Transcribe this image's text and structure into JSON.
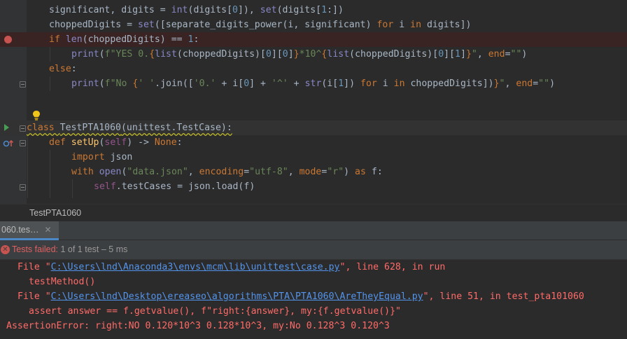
{
  "editor": {
    "lines": [
      {
        "id": "l1",
        "parts": [
          [
            "significant, digits = ",
            ""
          ],
          [
            "int",
            "bi"
          ],
          [
            "(digits[",
            ""
          ],
          [
            "0",
            "num"
          ],
          [
            "]), ",
            ""
          ],
          [
            "set",
            "bi"
          ],
          [
            "(digits[",
            ""
          ],
          [
            "1",
            "num"
          ],
          [
            ":])",
            ""
          ]
        ]
      },
      {
        "id": "l2",
        "parts": [
          [
            "choppedDigits = ",
            ""
          ],
          [
            "set",
            "bi"
          ],
          [
            "([separate_digits_power(i, significant) ",
            ""
          ],
          [
            "for",
            "kw"
          ],
          [
            " i ",
            ""
          ],
          [
            "in",
            "kw"
          ],
          [
            " digits])",
            ""
          ]
        ]
      },
      {
        "id": "l3",
        "parts": [
          [
            "if ",
            "kw"
          ],
          [
            "len",
            "bi"
          ],
          [
            "(choppedDigits) == ",
            ""
          ],
          [
            "1",
            "num"
          ],
          [
            ":",
            ""
          ]
        ]
      },
      {
        "id": "l4",
        "parts": [
          [
            "print",
            "bi"
          ],
          [
            "(",
            ""
          ],
          [
            "f\"YES 0.",
            "str"
          ],
          [
            "{",
            "esc"
          ],
          [
            "list",
            "bi"
          ],
          [
            "(choppedDigits)[",
            ""
          ],
          [
            "0",
            "num"
          ],
          [
            "][",
            ""
          ],
          [
            "0",
            "num"
          ],
          [
            "]",
            ""
          ],
          [
            "}",
            "esc"
          ],
          [
            "*10^",
            "str"
          ],
          [
            "{",
            "esc"
          ],
          [
            "list",
            "bi"
          ],
          [
            "(choppedDigits)[",
            ""
          ],
          [
            "0",
            "num"
          ],
          [
            "][",
            ""
          ],
          [
            "1",
            "num"
          ],
          [
            "]",
            ""
          ],
          [
            "}",
            "esc"
          ],
          [
            "\"",
            "str"
          ],
          [
            ", ",
            ""
          ],
          [
            "end",
            "kw"
          ],
          [
            "=",
            ""
          ],
          [
            "\"\"",
            "str"
          ],
          [
            ")",
            ""
          ]
        ]
      },
      {
        "id": "l5",
        "parts": [
          [
            "else",
            "kw"
          ],
          [
            ":",
            ""
          ]
        ]
      },
      {
        "id": "l6",
        "parts": [
          [
            "print",
            "bi"
          ],
          [
            "(",
            ""
          ],
          [
            "f\"No ",
            "str"
          ],
          [
            "{",
            "esc"
          ],
          [
            "' '",
            "str"
          ],
          [
            ".join([",
            ""
          ],
          [
            "'0.'",
            "str"
          ],
          [
            " + i[",
            ""
          ],
          [
            "0",
            "num"
          ],
          [
            "] + ",
            ""
          ],
          [
            "'^'",
            "str"
          ],
          [
            " + ",
            ""
          ],
          [
            "str",
            "bi"
          ],
          [
            "(i[",
            ""
          ],
          [
            "1",
            "num"
          ],
          [
            "]) ",
            ""
          ],
          [
            "for",
            "kw"
          ],
          [
            " i ",
            ""
          ],
          [
            "in",
            "kw"
          ],
          [
            " choppedDigits])",
            ""
          ],
          [
            "}",
            "esc"
          ],
          [
            "\"",
            "str"
          ],
          [
            ", ",
            ""
          ],
          [
            "end",
            "kw"
          ],
          [
            "=",
            ""
          ],
          [
            "\"\"",
            "str"
          ],
          [
            ")",
            ""
          ]
        ]
      },
      {
        "id": "l9",
        "parts": [
          [
            "class ",
            "kw"
          ],
          [
            "TestPTA1060",
            "cls"
          ],
          [
            "(unittest.TestCase):",
            ""
          ]
        ]
      },
      {
        "id": "l10",
        "parts": [
          [
            "def ",
            "kw"
          ],
          [
            "setUp",
            "fn"
          ],
          [
            "(",
            ""
          ],
          [
            "self",
            "slf"
          ],
          [
            ") -> ",
            ""
          ],
          [
            "None",
            "kw"
          ],
          [
            ":",
            ""
          ]
        ]
      },
      {
        "id": "l11",
        "parts": [
          [
            "import ",
            "kw"
          ],
          [
            "json",
            ""
          ]
        ]
      },
      {
        "id": "l12",
        "parts": [
          [
            "with ",
            "kw"
          ],
          [
            "open",
            "bi"
          ],
          [
            "(",
            ""
          ],
          [
            "\"data.json\"",
            "str"
          ],
          [
            ", ",
            ""
          ],
          [
            "encoding",
            "kw"
          ],
          [
            "=",
            ""
          ],
          [
            "\"utf-8\"",
            "str"
          ],
          [
            ", ",
            ""
          ],
          [
            "mode",
            "kw"
          ],
          [
            "=",
            ""
          ],
          [
            "\"r\"",
            "str"
          ],
          [
            ") ",
            ""
          ],
          [
            "as ",
            "kw"
          ],
          [
            "f:",
            ""
          ]
        ]
      },
      {
        "id": "l13",
        "parts": [
          [
            "self",
            "slf"
          ],
          [
            ".testCases = json.load(f)",
            ""
          ]
        ]
      }
    ]
  },
  "breadcrumb": {
    "item": "TestPTA1060"
  },
  "run_panel": {
    "tab_label": "060.tes…",
    "tab_close": "✕",
    "status_failed": "Tests failed:",
    "status_rest": " 1 of 1 test – 5 ms"
  },
  "console": {
    "line1_pre": "File \"",
    "line1_link": "C:\\Users\\lnd\\Anaconda3\\envs\\mcm\\lib\\unittest\\case.py",
    "line1_post": "\", line 628, in run",
    "line2": "testMethod()",
    "line3_pre": "File \"",
    "line3_link": "C:\\Users\\lnd\\Desktop\\ereaseo\\algorithms\\PTA\\PTA1060\\AreTheyEqual.py",
    "line3_post": "\", line 51, in test_pta101060",
    "line4": "assert answer == f.getvalue(), f\"right:{answer}, my:{f.getvalue()}\"",
    "line5": "AssertionError: right:NO 0.120*10^3 0.128*10^3, my:No 0.128^3 0.120^3"
  },
  "colors": {
    "background": "#2b2b2b",
    "breakpoint": "#c75450",
    "error_text": "#ff6b68",
    "link": "#5394ec",
    "tab_accent": "#4a88c7"
  }
}
